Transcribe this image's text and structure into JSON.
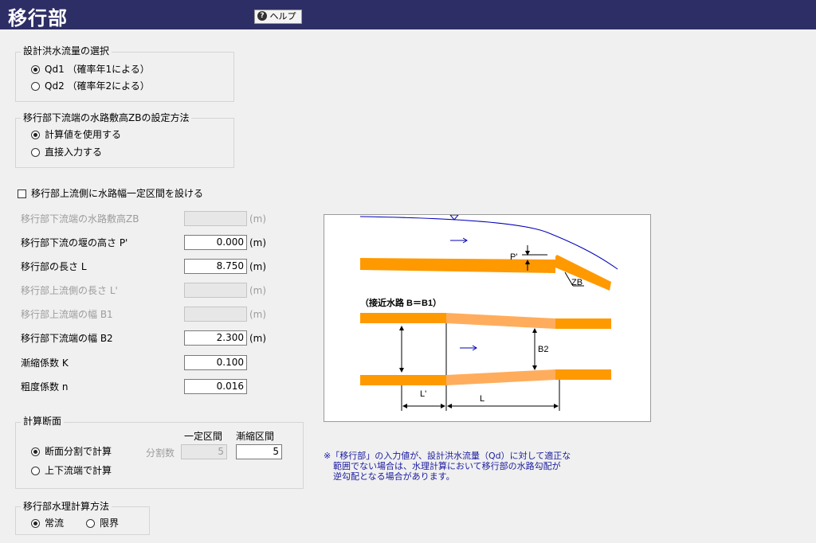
{
  "window": {
    "title": "移行部",
    "help_label": "ヘルプ"
  },
  "discharge": {
    "legend": "設計洪水流量の選択",
    "options": [
      {
        "label": "Qd1  （確率年1による）",
        "selected": true
      },
      {
        "label": "Qd2  （確率年2による）",
        "selected": false
      }
    ]
  },
  "zb_method": {
    "legend": "移行部下流端の水路敷高ZBの設定方法",
    "options": [
      {
        "label": "計算値を使用する",
        "selected": true
      },
      {
        "label": "直接入力する",
        "selected": false
      }
    ]
  },
  "constant_section": {
    "label": "移行部上流側に水路幅一定区間を設ける",
    "checked": false
  },
  "fields": [
    {
      "label": "移行部下流端の水路敷高ZB",
      "value": "",
      "unit": "(m)",
      "enabled": false
    },
    {
      "label": "移行部下流の堰の高さ P'",
      "value": "0.000",
      "unit": "(m)",
      "enabled": true
    },
    {
      "label": "移行部の長さ  L",
      "value": "8.750",
      "unit": "(m)",
      "enabled": true
    },
    {
      "label": "移行部上流側の長さ  L'",
      "value": "",
      "unit": "(m)",
      "enabled": false
    },
    {
      "label": "移行部上流端の幅  B1",
      "value": "",
      "unit": "(m)",
      "enabled": false
    },
    {
      "label": "移行部下流端の幅  B2",
      "value": "2.300",
      "unit": "(m)",
      "enabled": true
    },
    {
      "label": "漸縮係数 K",
      "value": "0.100",
      "unit": "",
      "enabled": true
    },
    {
      "label": "粗度係数  n",
      "value": "0.016",
      "unit": "",
      "enabled": true
    }
  ],
  "calc_section": {
    "legend": "計算断面",
    "options": [
      {
        "label": "断面分割で計算",
        "selected": true
      },
      {
        "label": "上下流端で計算",
        "selected": false
      }
    ],
    "col_const": "一定区間",
    "col_taper": "漸縮区間",
    "divisions_label": "分割数",
    "const_value": "5",
    "taper_value": "5"
  },
  "hydraulic": {
    "legend": "移行部水理計算方法",
    "options": [
      {
        "label": "常流",
        "selected": true
      },
      {
        "label": "限界",
        "selected": false
      }
    ]
  },
  "diagram": {
    "labels": {
      "p": "P'",
      "zb": "ZB",
      "approach": "（接近水路 B＝B1）",
      "b2": "B2",
      "l_prime": "L'",
      "l": "L"
    },
    "colors": {
      "channel": "#ff9900",
      "channel_light": "#ffad5c",
      "water": "#0000bb"
    }
  },
  "note": {
    "lines": [
      "※「移行部」の入力値が、設計洪水流量（Qd）に対して適正な",
      "範囲でない場合は、水理計算において移行部の水路勾配が",
      "逆勾配となる場合があります。"
    ]
  }
}
